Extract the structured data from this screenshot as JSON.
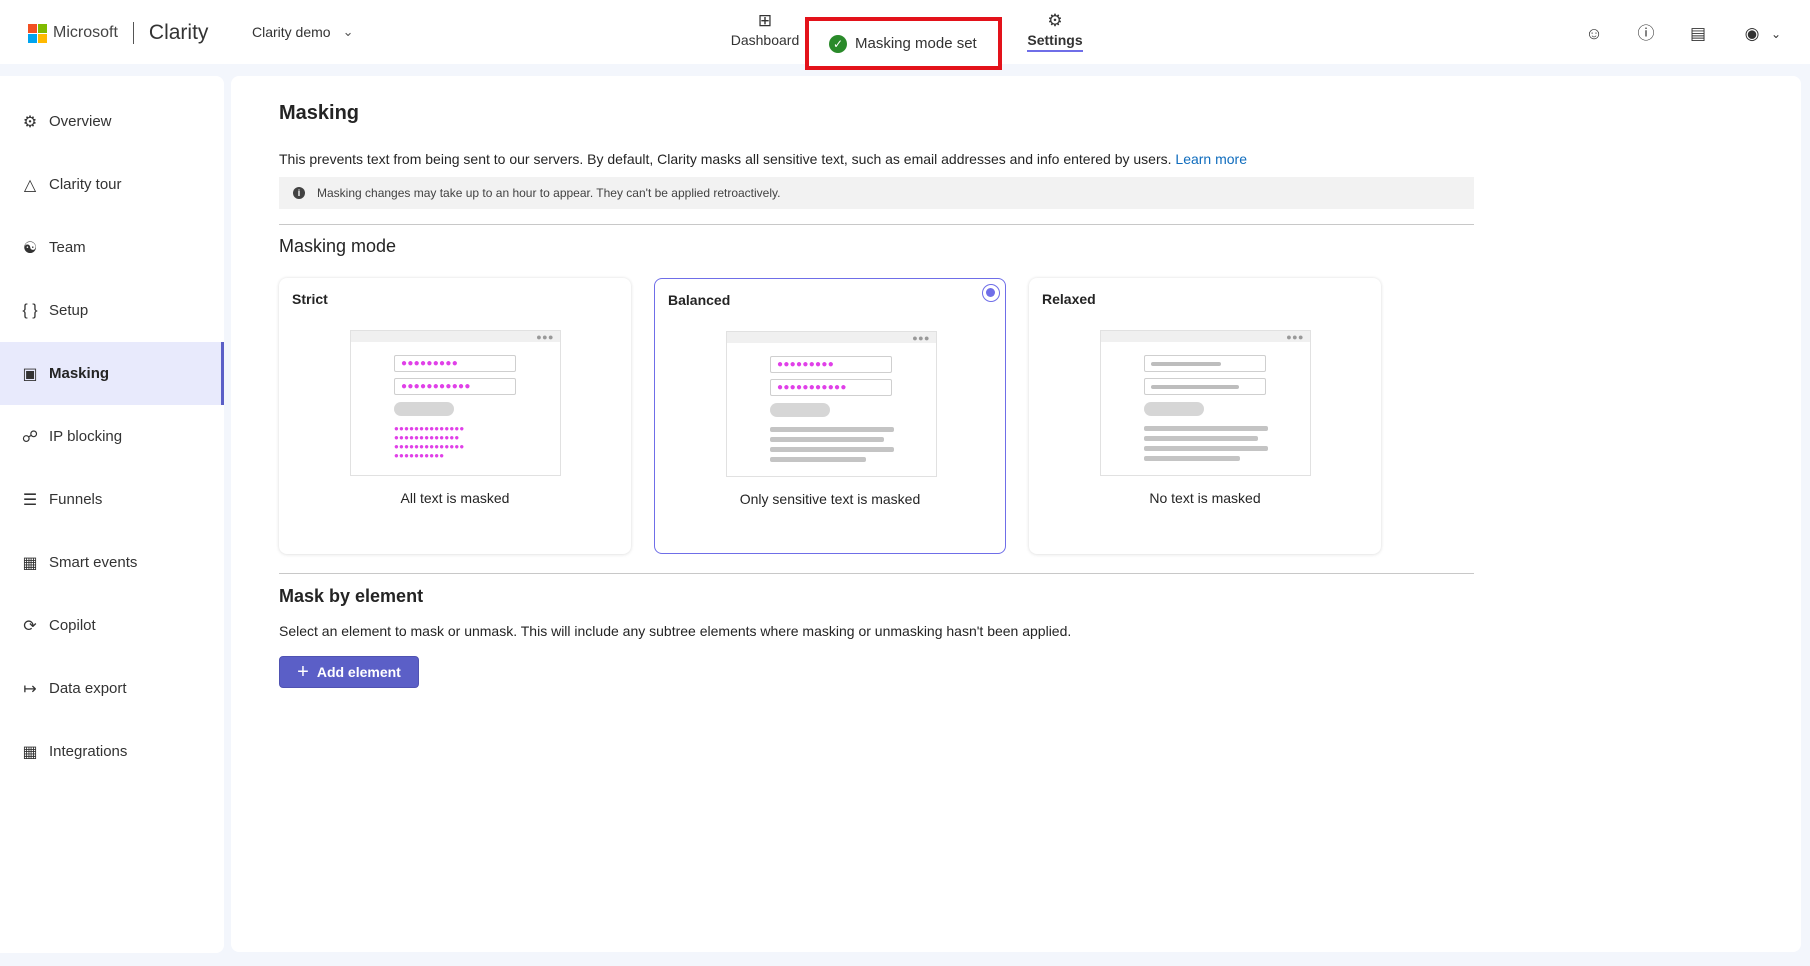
{
  "header": {
    "brand": "Microsoft",
    "product": "Clarity",
    "project": "Clarity demo",
    "nav": [
      {
        "label": "Dashboard",
        "icon": "dashboard-icon"
      },
      {
        "label": "Settings",
        "icon": "gear-icon"
      }
    ],
    "toast": "Masking mode set",
    "right_icons": [
      "share-user-icon",
      "help-icon",
      "document-icon",
      "account-icon",
      "chevron-down-icon"
    ]
  },
  "sidebar": {
    "items": [
      {
        "label": "Overview",
        "icon": "gear-icon"
      },
      {
        "label": "Clarity tour",
        "icon": "tour-icon"
      },
      {
        "label": "Team",
        "icon": "team-icon"
      },
      {
        "label": "Setup",
        "icon": "braces-icon"
      },
      {
        "label": "Masking",
        "icon": "masking-icon",
        "active": true
      },
      {
        "label": "IP blocking",
        "icon": "globe-block-icon"
      },
      {
        "label": "Funnels",
        "icon": "funnel-icon"
      },
      {
        "label": "Smart events",
        "icon": "smart-events-icon"
      },
      {
        "label": "Copilot",
        "icon": "copilot-icon"
      },
      {
        "label": "Data export",
        "icon": "export-icon"
      },
      {
        "label": "Integrations",
        "icon": "integrations-icon"
      }
    ]
  },
  "main": {
    "title": "Masking",
    "description": "This prevents text from being sent to our servers. By default, Clarity masks all sensitive text, such as email addresses and info entered by users.",
    "learn_more": "Learn more",
    "info": "Masking changes may take up to an hour to appear. They can't be applied retroactively.",
    "mode_title": "Masking mode",
    "modes": [
      {
        "title": "Strict",
        "caption": "All text is masked",
        "selected": false
      },
      {
        "title": "Balanced",
        "caption": "Only sensitive text is masked",
        "selected": true
      },
      {
        "title": "Relaxed",
        "caption": "No text is masked",
        "selected": false
      }
    ],
    "element_title": "Mask by element",
    "element_desc": "Select an element to mask or unmask. This will include any subtree elements where masking or unmasking hasn't been applied.",
    "add_button": "Add element"
  },
  "colors": {
    "accent": "#5b5fc7",
    "mask_pink": "#e040e8",
    "toast_border": "#e3121a",
    "success": "#2a8a2a",
    "link": "#0f6cbd"
  }
}
